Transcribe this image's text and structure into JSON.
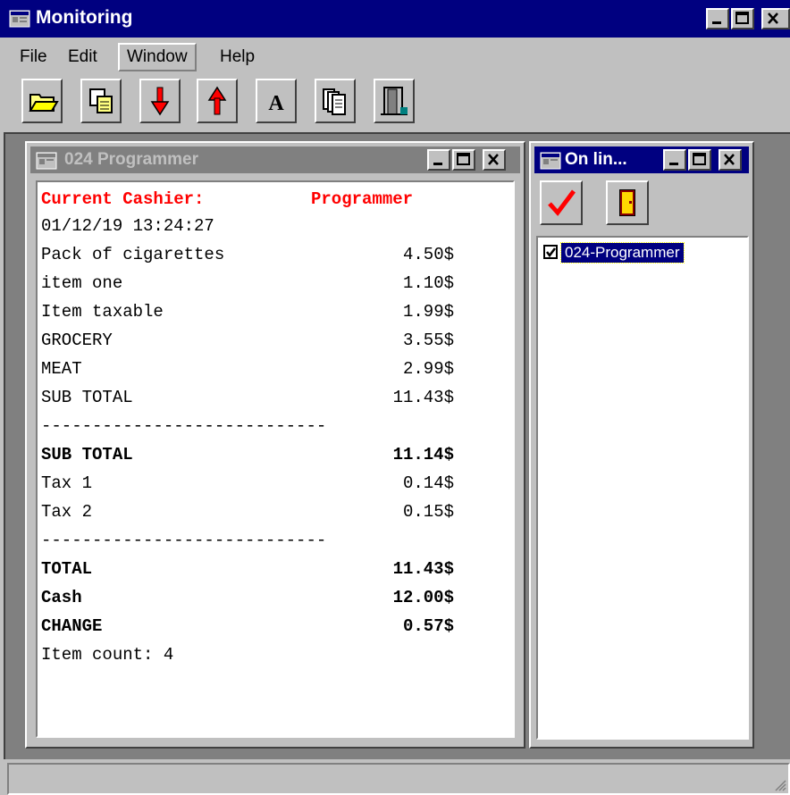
{
  "app": {
    "title": "Monitoring",
    "menu": [
      "File",
      "Edit",
      "Window",
      "Help"
    ]
  },
  "toolbar": {
    "buttons": [
      "open-folder-icon",
      "copy-icon",
      "arrow-down-icon",
      "arrow-up-icon",
      "font-icon",
      "pages-icon",
      "exit-door-icon"
    ],
    "font_glyph": "A"
  },
  "receipt_window": {
    "title": "024 Programmer",
    "cashier_label": "Current Cashier:",
    "cashier_name": "Programmer",
    "datetime": "01/12/19 13:24:27",
    "items": [
      {
        "name": "Pack of cigarettes",
        "price": "4.50$"
      },
      {
        "name": "item one",
        "price": "1.10$"
      },
      {
        "name": "Item taxable",
        "price": "1.99$"
      },
      {
        "name": "GROCERY",
        "price": "3.55$"
      },
      {
        "name": "MEAT",
        "price": "2.99$"
      },
      {
        "name": "SUB TOTAL",
        "price": "11.43$"
      }
    ],
    "separator": "----------------------------",
    "subtotal_label": "SUB TOTAL",
    "subtotal_value": "11.14$",
    "tax1_label": "Tax 1",
    "tax1_value": "0.14$",
    "tax2_label": "Tax 2",
    "tax2_value": "0.15$",
    "total_label": "TOTAL",
    "total_value": "11.43$",
    "cash_label": "Cash",
    "cash_value": "12.00$",
    "change_label": "CHANGE",
    "change_value": "0.57$",
    "item_count": "Item count: 4"
  },
  "online_window": {
    "title": "On lin...",
    "buttons": [
      "checkmark-icon",
      "exit-door-icon"
    ],
    "list": [
      {
        "label": "024-Programmer",
        "checked": true
      }
    ]
  },
  "colors": {
    "title_active": "#000080",
    "title_inactive": "#808080",
    "cashier_red": "#ff0000",
    "face": "#c0c0c0"
  }
}
